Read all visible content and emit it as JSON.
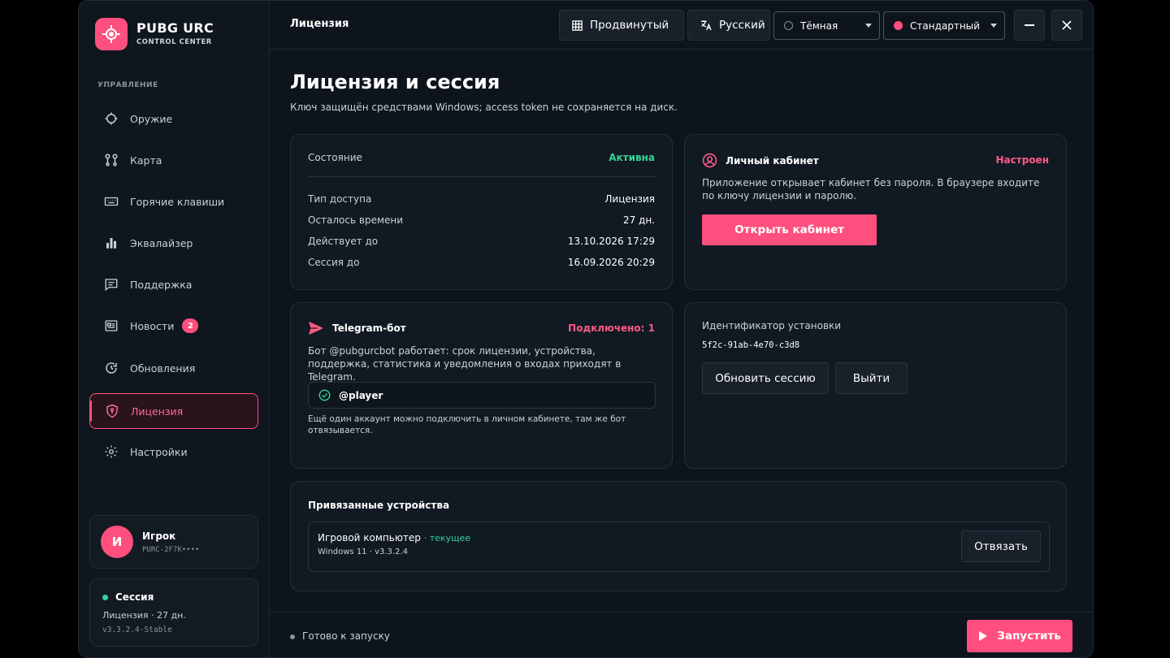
{
  "brand": {
    "title": "PUBG URC",
    "subtitle": "CONTROL CENTER"
  },
  "sidebar": {
    "section_label": "УПРАВЛЕНИЕ",
    "items": [
      {
        "label": "Оружие",
        "icon": "crosshair-icon"
      },
      {
        "label": "Карта",
        "icon": "map-route-icon"
      },
      {
        "label": "Горячие клавиши",
        "icon": "keyboard-icon"
      },
      {
        "label": "Эквалайзер",
        "icon": "equalizer-icon"
      },
      {
        "label": "Поддержка",
        "icon": "chat-icon"
      },
      {
        "label": "Новости",
        "icon": "news-icon",
        "badge": "2"
      },
      {
        "label": "Обновления",
        "icon": "refresh-icon"
      },
      {
        "label": "Лицензия",
        "icon": "shield-icon",
        "active": true
      },
      {
        "label": "Настройки",
        "icon": "gear-icon"
      }
    ],
    "user": {
      "initial": "И",
      "name": "Игрок",
      "key": "PURC-2F7K••••"
    },
    "session": {
      "title": "Сессия",
      "line": "Лицензия · 27 дн.",
      "version": "v3.3.2.4-Stable"
    }
  },
  "topbar": {
    "title": "Лицензия",
    "mode_label": "Продвинутый",
    "language_label": "Русский",
    "theme_value": "Тёмная",
    "accent_value": "Стандартный",
    "accent_color": "#ff4f7e"
  },
  "page": {
    "title": "Лицензия и сессия",
    "subtitle": "Ключ защищён средствами Windows; access token не сохраняется на диск."
  },
  "license_card": {
    "state_label": "Состояние",
    "state_value": "Активна",
    "rows": [
      {
        "label": "Тип доступа",
        "value": "Лицензия"
      },
      {
        "label": "Осталось времени",
        "value": "27 дн."
      },
      {
        "label": "Действует до",
        "value": "13.10.2026 17:29"
      },
      {
        "label": "Сессия до",
        "value": "16.09.2026 20:29"
      }
    ]
  },
  "cabinet_card": {
    "title": "Личный кабинет",
    "status": "Настроен",
    "description": "Приложение открывает кабинет без пароля. В браузере входите по ключу лицензии и паролю.",
    "button": "Открыть кабинет"
  },
  "telegram_card": {
    "title": "Telegram-бот",
    "status": "Подключено: 1",
    "description": "Бот @pubgurcbot работает: срок лицензии, устройства, поддержка, статистика и уведомления о входах приходят в Telegram.",
    "account": "@player",
    "note": "Ещё один аккаунт можно подключить в личном кабинете, там же бот отвязывается."
  },
  "install_card": {
    "label": "Идентификатор установки",
    "id": "5f2c-91ab-4e70-c3d8",
    "refresh_button": "Обновить сессию",
    "logout_button": "Выйти"
  },
  "devices_card": {
    "title": "Привязанные устройства",
    "devices": [
      {
        "name": "Игровой компьютер",
        "tag": "· текущее",
        "details": "Windows 11 · v3.3.2.4",
        "action": "Отвязать"
      }
    ]
  },
  "footer": {
    "status": "Готово к запуску",
    "launch_button": "Запустить"
  }
}
